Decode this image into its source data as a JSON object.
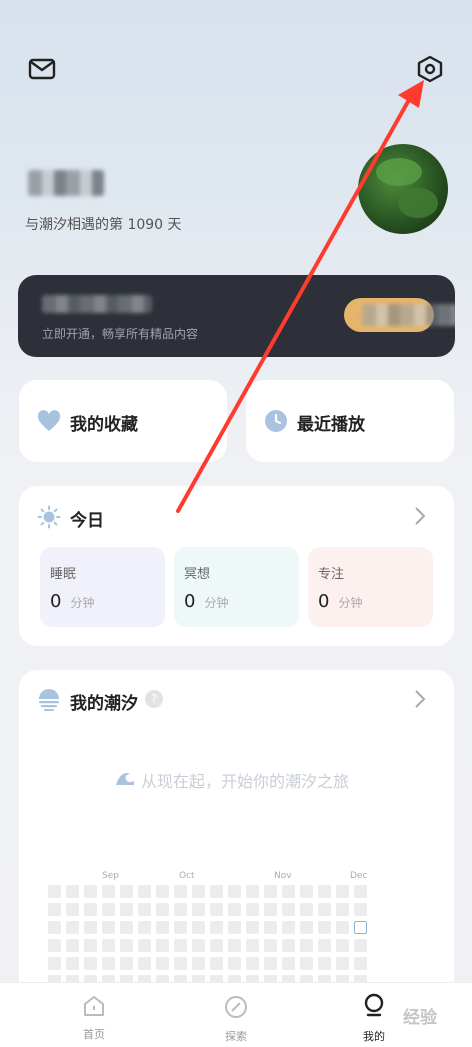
{
  "header": {
    "days_text": "与潮汐相遇的第 1090 天"
  },
  "vip": {
    "subtitle": "立即开通，畅享所有精品内容"
  },
  "quick": {
    "favorites": "我的收藏",
    "recent": "最近播放"
  },
  "today": {
    "title": "今日",
    "unit": "分钟",
    "stats": [
      {
        "label": "睡眠",
        "value": "0",
        "color": "#f0f1fb"
      },
      {
        "label": "冥想",
        "value": "0",
        "color": "#eef8f9"
      },
      {
        "label": "专注",
        "value": "0",
        "color": "#fcf1ef"
      }
    ]
  },
  "tide": {
    "title": "我的潮汐",
    "help": "?",
    "empty_text": "从现在起，开始你的潮汐之旅",
    "months": [
      "Sep",
      "Oct",
      "Nov",
      "Dec"
    ]
  },
  "nav": {
    "home": "首页",
    "explore": "探索",
    "mine": "我的"
  },
  "watermark": "经验",
  "colors": {
    "arrow": "#ff3b30",
    "vip_bg": "#2d3038",
    "vip_button": "#e5b56c"
  }
}
